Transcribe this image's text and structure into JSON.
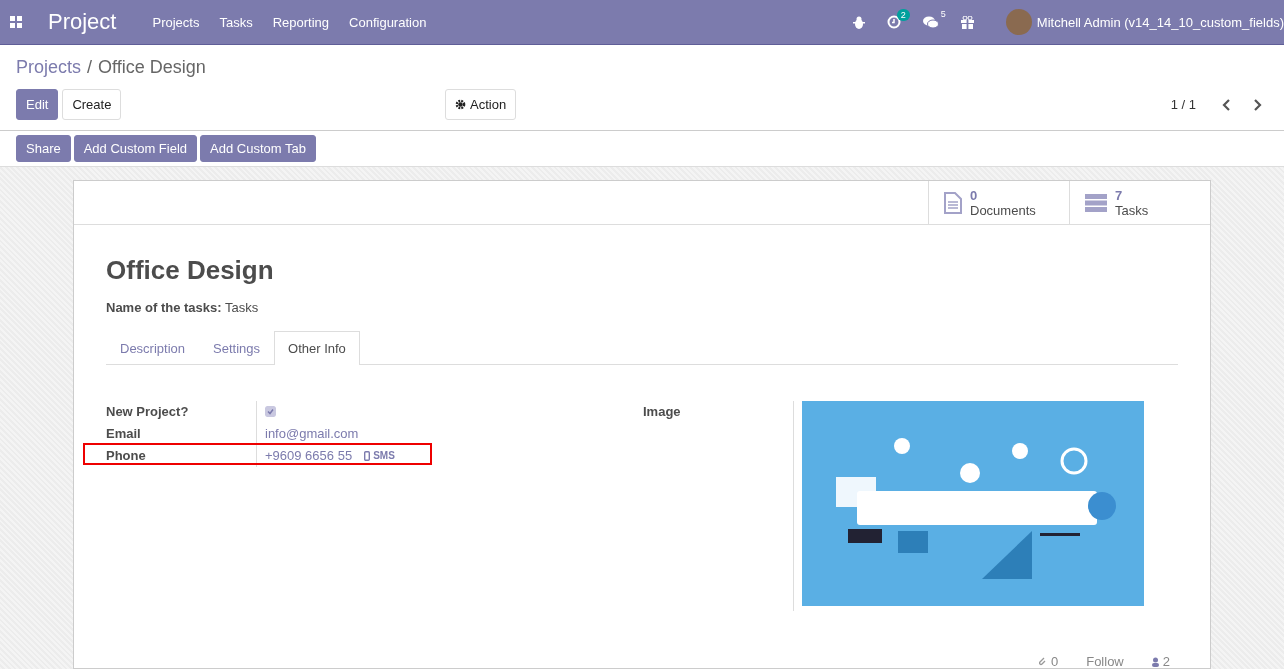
{
  "navbar": {
    "app_name": "Project",
    "menu": [
      "Projects",
      "Tasks",
      "Reporting",
      "Configuration"
    ],
    "activity_count": "2",
    "message_count": "5",
    "user": "Mitchell Admin (v14_14_10_custom_fields)"
  },
  "breadcrumb": {
    "parent": "Projects",
    "separator": "/",
    "current": "Office Design"
  },
  "buttons": [
    {
      "label": "Edit",
      "kind": "primary"
    },
    {
      "label": "Create",
      "kind": "secondary"
    }
  ],
  "action": "Action",
  "pager": "1 / 1",
  "custom_buttons": [
    "Share",
    "Add Custom Field",
    "Add Custom Tab"
  ],
  "smart_buttons": [
    {
      "count": "0",
      "label": "Documents",
      "kind": "documents"
    },
    {
      "count": "7",
      "label": "Tasks",
      "kind": "tasks"
    }
  ],
  "title": "Office Design",
  "tasks_name": {
    "label": "Name of the tasks:",
    "value": "Tasks"
  },
  "tabs": [
    {
      "label": "Description",
      "selected": false
    },
    {
      "label": "Settings",
      "selected": false
    },
    {
      "label": "Other Info",
      "selected": true
    }
  ],
  "fields": [
    {
      "label": "New Project?",
      "kind": "checkbox",
      "checked": true
    },
    {
      "label": "Email",
      "kind": "email",
      "value": "info@gmail.com",
      "highlighted": false
    },
    {
      "label": "Phone",
      "kind": "phone",
      "value": "+9609 6656 55",
      "action": "SMS",
      "highlighted": true
    }
  ],
  "image_field": {
    "label": "Image",
    "kind": "picture"
  },
  "chatter": {
    "attachments": "0",
    "follow": "Follow",
    "followers": "2"
  }
}
